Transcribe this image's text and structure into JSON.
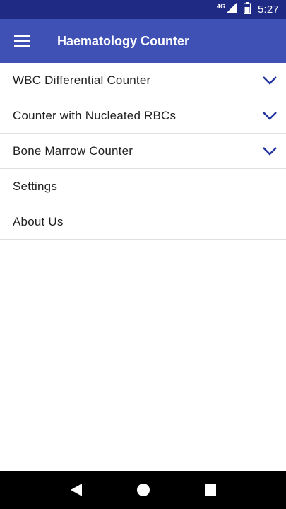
{
  "status_bar": {
    "network": "4G",
    "time": "5:27",
    "icons": [
      "signal-icon",
      "battery-icon"
    ]
  },
  "app_bar": {
    "title": "Haematology Counter",
    "menu_icon": "hamburger-menu-icon"
  },
  "menu": {
    "items": [
      {
        "label": "WBC Differential Counter",
        "expandable": true
      },
      {
        "label": "Counter with Nucleated RBCs",
        "expandable": true
      },
      {
        "label": "Bone Marrow Counter",
        "expandable": true
      },
      {
        "label": "Settings",
        "expandable": false
      },
      {
        "label": "About Us",
        "expandable": false
      }
    ]
  },
  "nav_bar": {
    "buttons": [
      "back-icon",
      "home-icon",
      "recents-icon"
    ]
  },
  "colors": {
    "status_bar": "#1f2a85",
    "app_bar": "#3f51b5",
    "chevron": "#2233a0",
    "divider": "#e0e0e0"
  }
}
